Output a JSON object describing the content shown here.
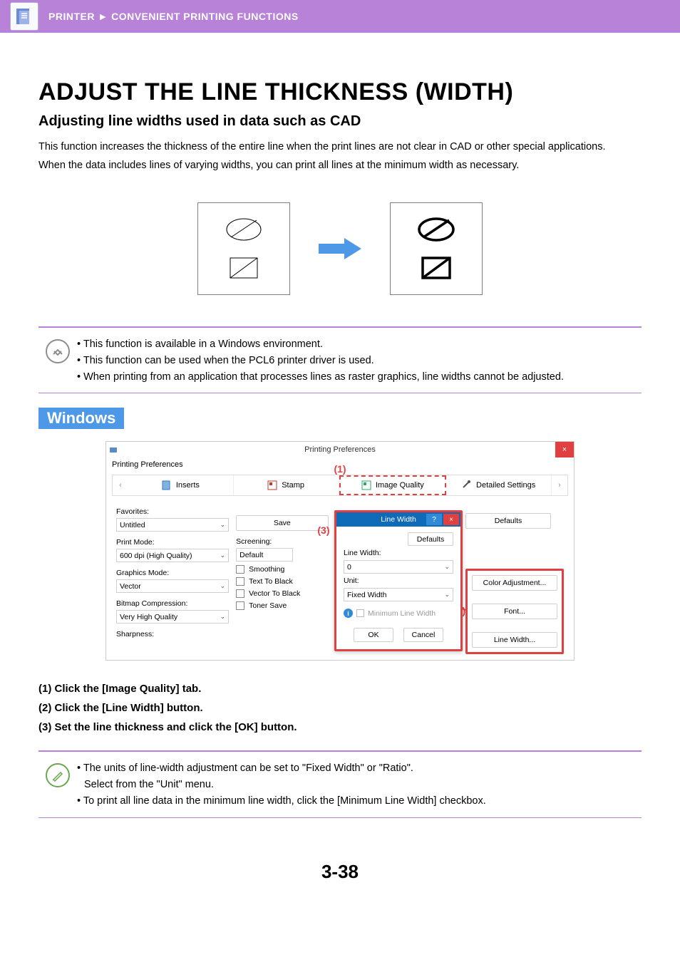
{
  "header": {
    "section": "PRINTER",
    "subsection": "CONVENIENT PRINTING FUNCTIONS"
  },
  "title": "ADJUST THE LINE THICKNESS (WIDTH)",
  "subtitle": "Adjusting line widths used in data such as CAD",
  "intro1": "This function increases the thickness of the entire line when the print lines are not clear in CAD or other special applications.",
  "intro2": "When the data includes lines of varying widths, you can print all lines at the minimum width as necessary.",
  "notes_top": [
    "This function is available in a Windows environment.",
    "This function can be used when the PCL6 printer driver is used.",
    "When printing from an application that processes lines as raster graphics, line widths cannot be adjusted."
  ],
  "os_label": "Windows",
  "callouts": {
    "c1": "(1)",
    "c2": "(2)",
    "c3": "(3)"
  },
  "window": {
    "title": "Printing Preferences",
    "tab_label": "Printing Preferences",
    "tabs": {
      "inserts": "Inserts",
      "stamp": "Stamp",
      "image_quality": "Image Quality",
      "detailed": "Detailed Settings"
    },
    "left": {
      "favorites_label": "Favorites:",
      "favorites_value": "Untitled",
      "save": "Save",
      "print_mode_label": "Print Mode:",
      "print_mode_value": "600 dpi (High Quality)",
      "graphics_mode_label": "Graphics Mode:",
      "graphics_mode_value": "Vector",
      "bitmap_label": "Bitmap Compression:",
      "bitmap_value": "Very High Quality",
      "sharpness_label": "Sharpness:"
    },
    "mid": {
      "screening_label": "Screening:",
      "screening_value": "Default",
      "smoothing": "Smoothing",
      "text_to_black": "Text To Black",
      "vector_to_black": "Vector To Black",
      "toner_save": "Toner Save"
    },
    "right": {
      "defaults": "Defaults",
      "color_adjustment": "Color Adjustment...",
      "font": "Font...",
      "line_width": "Line Width..."
    },
    "popup": {
      "title": "Line Width",
      "defaults": "Defaults",
      "line_width_label": "Line Width:",
      "line_width_value": "0",
      "unit_label": "Unit:",
      "unit_value": "Fixed Width",
      "min_line": "Minimum Line Width",
      "ok": "OK",
      "cancel": "Cancel"
    }
  },
  "steps": {
    "s1": "(1)  Click the [Image Quality] tab.",
    "s2": "(2)  Click the [Line Width] button.",
    "s3": "(3)  Set the line thickness and click the [OK] button."
  },
  "notes_bottom": {
    "n1a": "The units of line-width adjustment can be set to \"Fixed Width\" or \"Ratio\".",
    "n1b": "Select from the \"Unit\" menu.",
    "n2": "To print all line data in the minimum line width, click the [Minimum Line Width] checkbox."
  },
  "page_num": "3-38"
}
